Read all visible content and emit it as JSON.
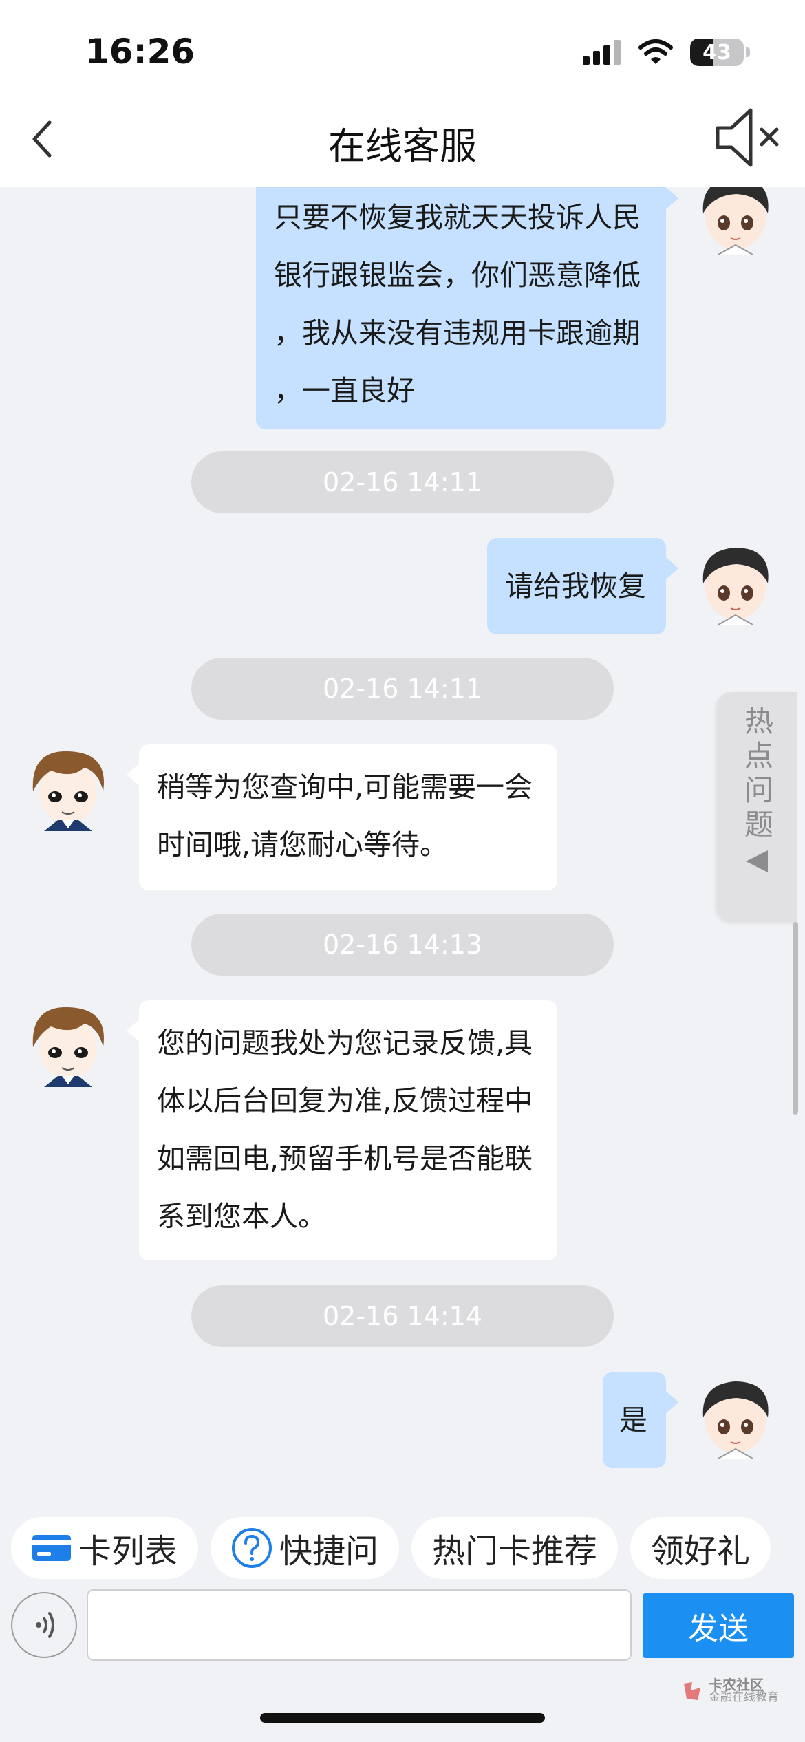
{
  "status_bar": {
    "time": "16:26",
    "battery": "43",
    "battery_level": 0.43
  },
  "header": {
    "title": "在线客服",
    "back_icon": "chevron-left-icon",
    "sound_icon": "speaker-muted-icon"
  },
  "messages": [
    {
      "role": "user",
      "lines": [
        "只要不恢复我就天天投诉人民",
        "银行跟银监会，你们恶意降低",
        "，我从来没有违规用卡跟逾期",
        "，一直良好"
      ]
    },
    {
      "role": "time",
      "text": "02-16 14:11"
    },
    {
      "role": "user",
      "lines": [
        "请给我恢复"
      ]
    },
    {
      "role": "time",
      "text": "02-16 14:11"
    },
    {
      "role": "agent",
      "lines": [
        "稍等为您查询中,可能需要一会",
        "时间哦,请您耐心等待。"
      ]
    },
    {
      "role": "time",
      "text": "02-16 14:13"
    },
    {
      "role": "agent",
      "lines": [
        "您的问题我处为您记录反馈,具",
        "体以后台回复为准,反馈过程中",
        "如需回电,预留手机号是否能联",
        "系到您本人。"
      ]
    },
    {
      "role": "time",
      "text": "02-16 14:14"
    },
    {
      "role": "user",
      "lines": [
        "是"
      ]
    }
  ],
  "side_tab": {
    "label": "热点问题"
  },
  "quick_chips": [
    {
      "label": "卡列表",
      "icon": "credit-card-icon"
    },
    {
      "label": "快捷问",
      "icon": "question-circle-icon"
    },
    {
      "label": "热门卡推荐",
      "icon": ""
    },
    {
      "label": "领好礼",
      "icon": ""
    }
  ],
  "input": {
    "value": "",
    "placeholder": "",
    "send_label": "发送",
    "voice_icon": "voice-wave-icon"
  },
  "watermark": {
    "line1": "卡农社区",
    "line2": "金融在线教育"
  },
  "colors": {
    "user_bubble": "#c6e1ff",
    "agent_bubble": "#ffffff",
    "send_button": "#1b8ff2",
    "background": "#f1f2f6"
  }
}
